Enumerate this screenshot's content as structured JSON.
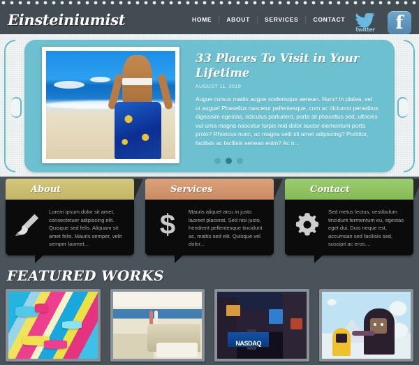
{
  "site": {
    "logo": "Einsteiniumist"
  },
  "nav": {
    "items": [
      {
        "label": "HOME"
      },
      {
        "label": "ABOUT"
      },
      {
        "label": "SERVICES"
      },
      {
        "label": "CONTACT"
      }
    ]
  },
  "social": {
    "twitter_label": "twitter",
    "twitter_icon": "twitter-bird-icon",
    "facebook_label": "f",
    "facebook_icon": "facebook-icon"
  },
  "slider": {
    "title": "33 Places To Visit in Your Lifetime",
    "date": "AUGUST 11, 2010",
    "body": "Augue cursus mattis augue scelerisque aenean. Nunc! In platea, vel ut augue! Phasellus nascetur pellentesque, cum ac dictumst penatibus dignissim egestas, ridiculus parturient, porta sit phasellus sed, ultricies vut urna magna nascetur turpis mid dolor auctor elementum porta proin? Rhoncus nunc, ac magna velit sit amet adipiscing? Porttitor, facilisis ac facilisis aenean enim? Ac n...",
    "image_alt": "beach-woman-photo",
    "pagination": {
      "count": 3,
      "active_index": 1
    }
  },
  "boxes": [
    {
      "title": "About",
      "color": "#cfc06a",
      "icon": "paintbrush-icon",
      "text": "Lorem ipsum dolor sit amet, consectetuer adipiscing elit. Quisque sed felis. Aliquam sit amet felis. Mauris semper, velit semper laoreet..."
    },
    {
      "title": "Services",
      "color": "#d79468",
      "icon": "dollar-icon",
      "icon_glyph": "$",
      "text": "Mauris aliquet arcu in justo laoreet placerat. Sed nisi justo, hendrerit pellentesque tincidunt ac, mattis sed elit. Quisque vel dolor..."
    },
    {
      "title": "Contact",
      "color": "#8dc65a",
      "icon": "gear-icon",
      "text": "Sed metus lectus, vestibulum tincidunt fermentum eu, egestas eget dui. Duis neque est, accumsan sed facilisis sed, suscipit ac eros...."
    }
  ],
  "featured": {
    "heading": "FEATURED WORKS",
    "thumbs": [
      {
        "name": "colorful-ribbons-thumb"
      },
      {
        "name": "yacht-deck-thumb"
      },
      {
        "name": "times-square-thumb",
        "sign_label": "NASDAQ"
      },
      {
        "name": "cartoon-characters-thumb"
      }
    ]
  },
  "colors": {
    "page_bg": "#4a525a",
    "header_bg": "#434b53",
    "slider_bg": "#6dc0cf",
    "box_dark": "#0b0b0b"
  }
}
